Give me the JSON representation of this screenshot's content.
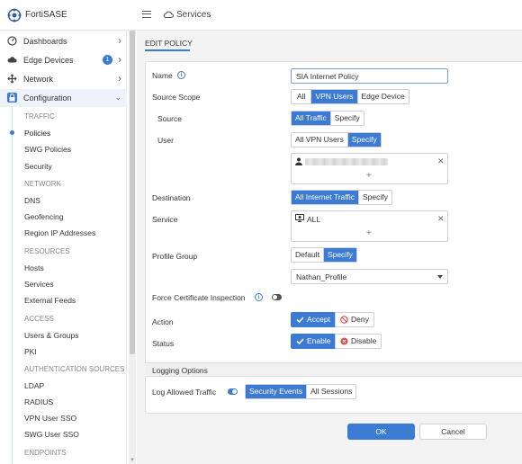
{
  "app": {
    "name": "FortiSASE"
  },
  "header": {
    "breadcrumb": "Services"
  },
  "sidebar": {
    "items": [
      {
        "label": "Dashboards",
        "icon": "dashboard-icon"
      },
      {
        "label": "Edge Devices",
        "icon": "cloud-icon",
        "badge": "1"
      },
      {
        "label": "Network",
        "icon": "network-icon"
      },
      {
        "label": "Configuration",
        "icon": "lock-icon"
      }
    ],
    "sections": [
      {
        "header": "TRAFFIC",
        "items": [
          "Policies",
          "SWG Policies",
          "Security"
        ]
      },
      {
        "header": "NETWORK",
        "items": [
          "DNS",
          "Geofencing",
          "Region IP Addresses"
        ]
      },
      {
        "header": "RESOURCES",
        "items": [
          "Hosts",
          "Services",
          "External Feeds"
        ]
      },
      {
        "header": "ACCESS",
        "items": [
          "Users & Groups",
          "PKI"
        ]
      },
      {
        "header": "AUTHENTICATION SOURCES",
        "items": [
          "LDAP",
          "RADIUS",
          "VPN User SSO",
          "SWG User SSO"
        ]
      },
      {
        "header": "ENDPOINTS",
        "items": []
      }
    ],
    "active_item": "Policies"
  },
  "page": {
    "title": "EDIT POLICY"
  },
  "form": {
    "name": {
      "label": "Name",
      "value": "SIA Internet Policy"
    },
    "source_scope": {
      "label": "Source Scope",
      "options": [
        "All",
        "VPN Users",
        "Edge Device"
      ],
      "selected": "VPN Users"
    },
    "source": {
      "label": "Source",
      "options": [
        "All Traffic",
        "Specify"
      ],
      "selected": "All Traffic"
    },
    "user": {
      "label": "User",
      "options": [
        "All VPN Users",
        "Specify"
      ],
      "selected": "Specify",
      "add": "+"
    },
    "destination": {
      "label": "Destination",
      "options": [
        "All Internet Traffic",
        "Specify"
      ],
      "selected": "All Internet Traffic"
    },
    "service": {
      "label": "Service",
      "entries": [
        "ALL"
      ],
      "add": "+"
    },
    "profile_group": {
      "label": "Profile Group",
      "options": [
        "Default",
        "Specify"
      ],
      "selected": "Specify",
      "value": "Nathan_Profile"
    },
    "force_cert": {
      "label": "Force Certificate Inspection",
      "enabled": false
    },
    "action": {
      "label": "Action",
      "options": [
        "Accept",
        "Deny"
      ],
      "selected": "Accept"
    },
    "status": {
      "label": "Status",
      "options": [
        "Enable",
        "Disable"
      ],
      "selected": "Enable"
    }
  },
  "logging": {
    "header": "Logging Options",
    "label": "Log Allowed Traffic",
    "enabled": true,
    "options": [
      "Security Events",
      "All Sessions"
    ],
    "selected": "Security Events"
  },
  "buttons": {
    "ok": "OK",
    "cancel": "Cancel"
  },
  "colors": {
    "accent": "#3b7bd4",
    "deny": "#d9534f"
  }
}
